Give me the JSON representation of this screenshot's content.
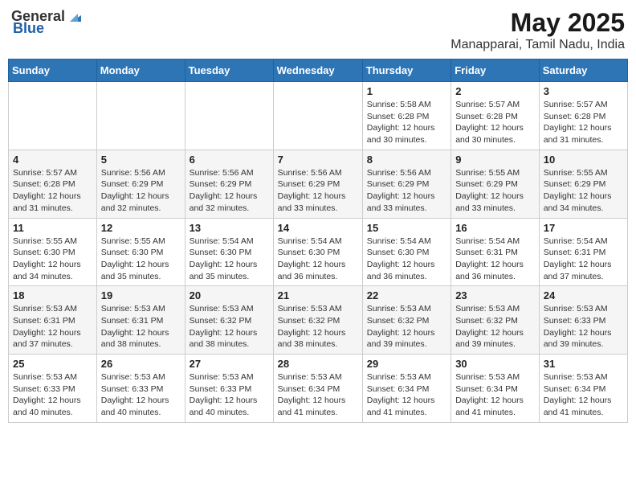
{
  "header": {
    "logo_general": "General",
    "logo_blue": "Blue",
    "title": "May 2025",
    "subtitle": "Manapparai, Tamil Nadu, India"
  },
  "days_of_week": [
    "Sunday",
    "Monday",
    "Tuesday",
    "Wednesday",
    "Thursday",
    "Friday",
    "Saturday"
  ],
  "weeks": [
    [
      {
        "day": "",
        "info": ""
      },
      {
        "day": "",
        "info": ""
      },
      {
        "day": "",
        "info": ""
      },
      {
        "day": "",
        "info": ""
      },
      {
        "day": "1",
        "info": "Sunrise: 5:58 AM\nSunset: 6:28 PM\nDaylight: 12 hours\nand 30 minutes."
      },
      {
        "day": "2",
        "info": "Sunrise: 5:57 AM\nSunset: 6:28 PM\nDaylight: 12 hours\nand 30 minutes."
      },
      {
        "day": "3",
        "info": "Sunrise: 5:57 AM\nSunset: 6:28 PM\nDaylight: 12 hours\nand 31 minutes."
      }
    ],
    [
      {
        "day": "4",
        "info": "Sunrise: 5:57 AM\nSunset: 6:28 PM\nDaylight: 12 hours\nand 31 minutes."
      },
      {
        "day": "5",
        "info": "Sunrise: 5:56 AM\nSunset: 6:29 PM\nDaylight: 12 hours\nand 32 minutes."
      },
      {
        "day": "6",
        "info": "Sunrise: 5:56 AM\nSunset: 6:29 PM\nDaylight: 12 hours\nand 32 minutes."
      },
      {
        "day": "7",
        "info": "Sunrise: 5:56 AM\nSunset: 6:29 PM\nDaylight: 12 hours\nand 33 minutes."
      },
      {
        "day": "8",
        "info": "Sunrise: 5:56 AM\nSunset: 6:29 PM\nDaylight: 12 hours\nand 33 minutes."
      },
      {
        "day": "9",
        "info": "Sunrise: 5:55 AM\nSunset: 6:29 PM\nDaylight: 12 hours\nand 33 minutes."
      },
      {
        "day": "10",
        "info": "Sunrise: 5:55 AM\nSunset: 6:29 PM\nDaylight: 12 hours\nand 34 minutes."
      }
    ],
    [
      {
        "day": "11",
        "info": "Sunrise: 5:55 AM\nSunset: 6:30 PM\nDaylight: 12 hours\nand 34 minutes."
      },
      {
        "day": "12",
        "info": "Sunrise: 5:55 AM\nSunset: 6:30 PM\nDaylight: 12 hours\nand 35 minutes."
      },
      {
        "day": "13",
        "info": "Sunrise: 5:54 AM\nSunset: 6:30 PM\nDaylight: 12 hours\nand 35 minutes."
      },
      {
        "day": "14",
        "info": "Sunrise: 5:54 AM\nSunset: 6:30 PM\nDaylight: 12 hours\nand 36 minutes."
      },
      {
        "day": "15",
        "info": "Sunrise: 5:54 AM\nSunset: 6:30 PM\nDaylight: 12 hours\nand 36 minutes."
      },
      {
        "day": "16",
        "info": "Sunrise: 5:54 AM\nSunset: 6:31 PM\nDaylight: 12 hours\nand 36 minutes."
      },
      {
        "day": "17",
        "info": "Sunrise: 5:54 AM\nSunset: 6:31 PM\nDaylight: 12 hours\nand 37 minutes."
      }
    ],
    [
      {
        "day": "18",
        "info": "Sunrise: 5:53 AM\nSunset: 6:31 PM\nDaylight: 12 hours\nand 37 minutes."
      },
      {
        "day": "19",
        "info": "Sunrise: 5:53 AM\nSunset: 6:31 PM\nDaylight: 12 hours\nand 38 minutes."
      },
      {
        "day": "20",
        "info": "Sunrise: 5:53 AM\nSunset: 6:32 PM\nDaylight: 12 hours\nand 38 minutes."
      },
      {
        "day": "21",
        "info": "Sunrise: 5:53 AM\nSunset: 6:32 PM\nDaylight: 12 hours\nand 38 minutes."
      },
      {
        "day": "22",
        "info": "Sunrise: 5:53 AM\nSunset: 6:32 PM\nDaylight: 12 hours\nand 39 minutes."
      },
      {
        "day": "23",
        "info": "Sunrise: 5:53 AM\nSunset: 6:32 PM\nDaylight: 12 hours\nand 39 minutes."
      },
      {
        "day": "24",
        "info": "Sunrise: 5:53 AM\nSunset: 6:33 PM\nDaylight: 12 hours\nand 39 minutes."
      }
    ],
    [
      {
        "day": "25",
        "info": "Sunrise: 5:53 AM\nSunset: 6:33 PM\nDaylight: 12 hours\nand 40 minutes."
      },
      {
        "day": "26",
        "info": "Sunrise: 5:53 AM\nSunset: 6:33 PM\nDaylight: 12 hours\nand 40 minutes."
      },
      {
        "day": "27",
        "info": "Sunrise: 5:53 AM\nSunset: 6:33 PM\nDaylight: 12 hours\nand 40 minutes."
      },
      {
        "day": "28",
        "info": "Sunrise: 5:53 AM\nSunset: 6:34 PM\nDaylight: 12 hours\nand 41 minutes."
      },
      {
        "day": "29",
        "info": "Sunrise: 5:53 AM\nSunset: 6:34 PM\nDaylight: 12 hours\nand 41 minutes."
      },
      {
        "day": "30",
        "info": "Sunrise: 5:53 AM\nSunset: 6:34 PM\nDaylight: 12 hours\nand 41 minutes."
      },
      {
        "day": "31",
        "info": "Sunrise: 5:53 AM\nSunset: 6:34 PM\nDaylight: 12 hours\nand 41 minutes."
      }
    ]
  ]
}
